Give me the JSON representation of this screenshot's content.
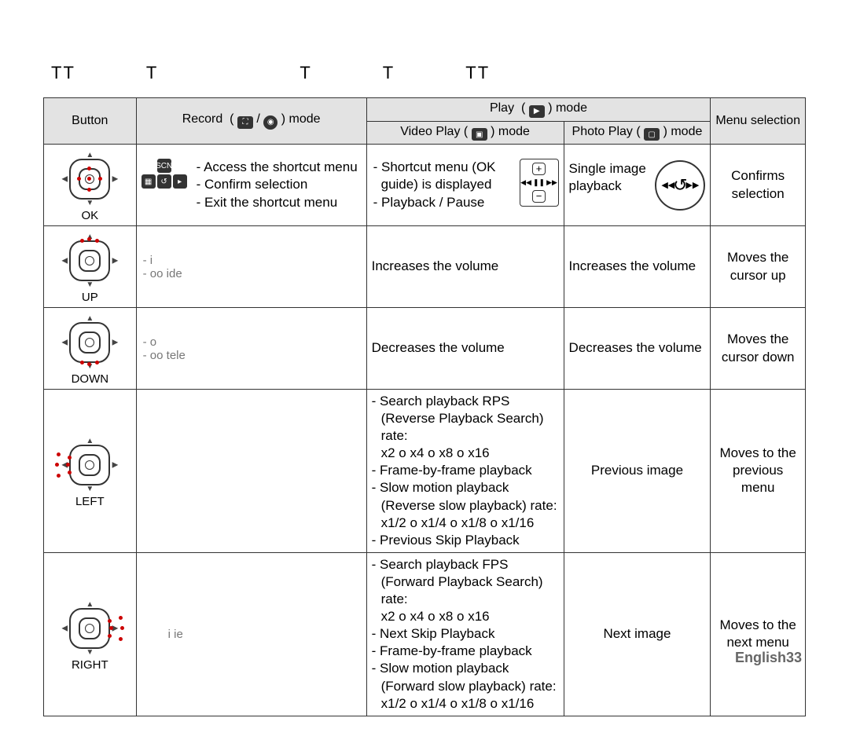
{
  "title_bar": [
    "TT",
    "T",
    "T",
    "T",
    "TT"
  ],
  "headers": {
    "button": "Button",
    "record": "Record  (      /      ) mode",
    "play": "Play  (      ) mode",
    "video": "Video Play (        ) mode",
    "photo": "Photo Play (        ) mode",
    "menu": "Menu selection"
  },
  "rows": {
    "ok": {
      "name": "OK",
      "record": [
        "Access the shortcut menu",
        "Conﬁrm selection",
        "Exit the shortcut menu"
      ],
      "video": [
        "Shortcut menu (OK guide) is displayed",
        "Playback / Pause"
      ],
      "photo": "Single image playback",
      "menu": "Conﬁrms selection"
    },
    "up": {
      "name": "UP",
      "record_notes": [
        "i",
        "oo ide"
      ],
      "video": "Increases the volume",
      "photo": "Increases the volume",
      "menu": "Moves the cursor up"
    },
    "down": {
      "name": "DOWN",
      "record_notes": [
        "o",
        "oo tele"
      ],
      "video": "Decreases the volume",
      "photo": "Decreases the volume",
      "menu": "Moves the cursor down"
    },
    "left": {
      "name": "LEFT",
      "video_lines": [
        "Search playback RPS",
        "(Reverse Playback Search) rate:",
        "x2 o x4 o x8 o x16",
        "Frame-by-frame playback",
        "Slow motion playback",
        "(Reverse slow playback) rate:",
        "x1/2 o x1/4 o x1/8 o x1/16",
        "Previous Skip Playback"
      ],
      "photo": "Previous image",
      "menu": "Moves to the previous menu"
    },
    "right": {
      "name": "RIGHT",
      "record_note": "i ie",
      "video_lines": [
        "Search playback FPS",
        "(Forward Playback Search) rate:",
        "x2 o x4 o x8 o x16",
        "Next Skip Playback",
        "Frame-by-frame playback",
        "Slow motion playback",
        "(Forward slow playback) rate:",
        "x1/2 o x1/4 o x1/8 o x1/16"
      ],
      "photo": "Next image",
      "menu": "Moves to the next menu"
    }
  },
  "footer": {
    "lang": "English",
    "page": "33"
  }
}
